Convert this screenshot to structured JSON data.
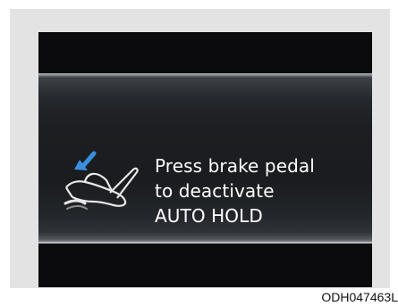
{
  "display": {
    "icon": "brake-pedal-foot-icon",
    "message_lines": [
      "Press brake pedal",
      "to deactivate",
      "AUTO HOLD"
    ]
  },
  "caption": "ODH047463L",
  "colors": {
    "screen_background": "#0b0b0d",
    "message_text": "#ffffff",
    "arrow": "#3b8fe0",
    "frame": "#e3e3e4"
  }
}
